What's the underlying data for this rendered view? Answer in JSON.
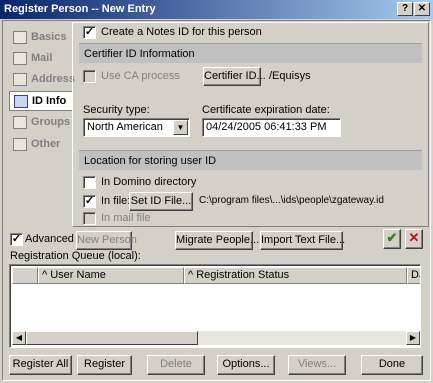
{
  "window": {
    "title": "Register Person -- New Entry",
    "help_glyph": "?",
    "close_glyph": "✕"
  },
  "sidebar": {
    "items": [
      {
        "label": "Basics",
        "icon": "basics-icon"
      },
      {
        "label": "Mail",
        "icon": "mail-icon"
      },
      {
        "label": "Address",
        "icon": "address-icon"
      },
      {
        "label": "ID Info",
        "icon": "id-info-icon"
      },
      {
        "label": "Groups",
        "icon": "groups-icon"
      },
      {
        "label": "Other",
        "icon": "other-icon"
      }
    ],
    "active": "ID Info"
  },
  "id_info": {
    "create_notes_id": {
      "label": "Create a Notes ID for this person",
      "checked": true,
      "mark": "✓"
    },
    "certifier_section": "Certifier ID Information",
    "use_ca_process": {
      "label": "Use CA process",
      "checked": false
    },
    "certifier_id_button": "Certifier ID...",
    "certifier_name": "/Equisys",
    "security_type_label": "Security type:",
    "security_type_value": "North American",
    "expiration_label": "Certificate expiration date:",
    "expiration_value": "04/24/2005 06:41:33 PM",
    "location_section": "Location for storing user ID",
    "in_domino_directory": {
      "label": "In Domino directory",
      "checked": false
    },
    "in_file": {
      "label": "In file:",
      "checked": true,
      "mark": "✓"
    },
    "set_id_file_button": "Set ID File...",
    "id_file_path": "C:\\program files\\...\\ids\\people\\zgateway.id",
    "in_mail_file": {
      "label": "In mail file",
      "checked": false
    }
  },
  "toolbar": {
    "advanced": {
      "label": "Advanced",
      "checked": true,
      "mark": "✓"
    },
    "new_person": "New Person",
    "migrate_people": "Migrate People...",
    "import_text_file": "Import Text File...",
    "confirm_glyph": "✔",
    "remove_glyph": "✕"
  },
  "queue": {
    "label": "Registration Queue (local):",
    "columns": [
      "User Name",
      "Registration Status",
      "Date"
    ],
    "sort_glyph": "^",
    "rows": []
  },
  "footer": {
    "register_all": "Register All",
    "register": "Register",
    "delete": "Delete",
    "options": "Options...",
    "views": "Views...",
    "done": "Done"
  },
  "colors": {
    "title_gradient_start": "#0a246a",
    "title_gradient_end": "#a6caf0",
    "confirm_green": "#1a8a1a",
    "remove_red": "#c01010"
  }
}
